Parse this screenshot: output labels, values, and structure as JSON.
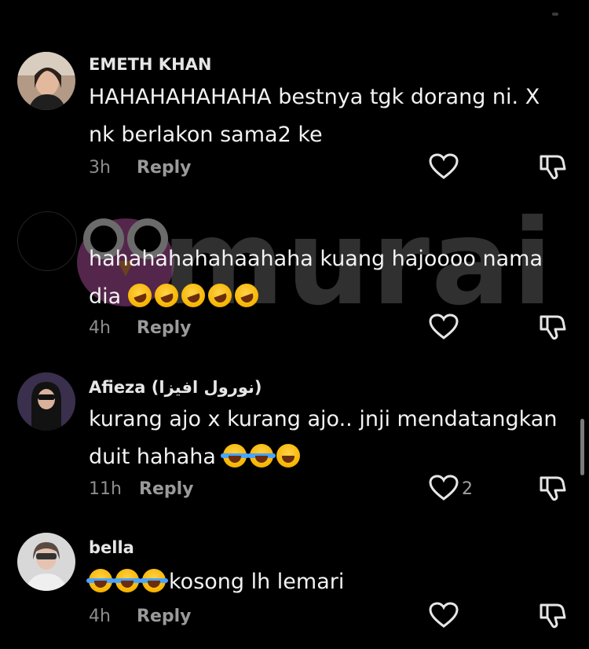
{
  "watermark": {
    "text": "murai"
  },
  "comments": [
    {
      "username": "EMETH KHAN",
      "text": "HAHAHAHAHAHA bestnya tgk dorang ni. X nk berlakon sama2 ke",
      "time": "3h",
      "reply_label": "Reply",
      "likes": ""
    },
    {
      "username": "",
      "text": "hahahahahahaahaha kuang hajoooo nama dia",
      "time": "4h",
      "reply_label": "Reply",
      "likes": ""
    },
    {
      "username": "Afieza (نورول افيزا)",
      "text": "kurang ajo x kurang ajo.. jnji mendatangkan duit hahaha",
      "time": "11h",
      "reply_label": "Reply",
      "likes": "2"
    },
    {
      "username": "bella",
      "text": "kosong lh lemari",
      "time": "4h",
      "reply_label": "Reply",
      "likes": ""
    }
  ],
  "icons": {
    "like": "heart-icon",
    "dislike": "thumbs-down-icon"
  },
  "colors": {
    "background": "#000000",
    "text": "#f2f2f2",
    "muted": "#8d8d8d"
  }
}
